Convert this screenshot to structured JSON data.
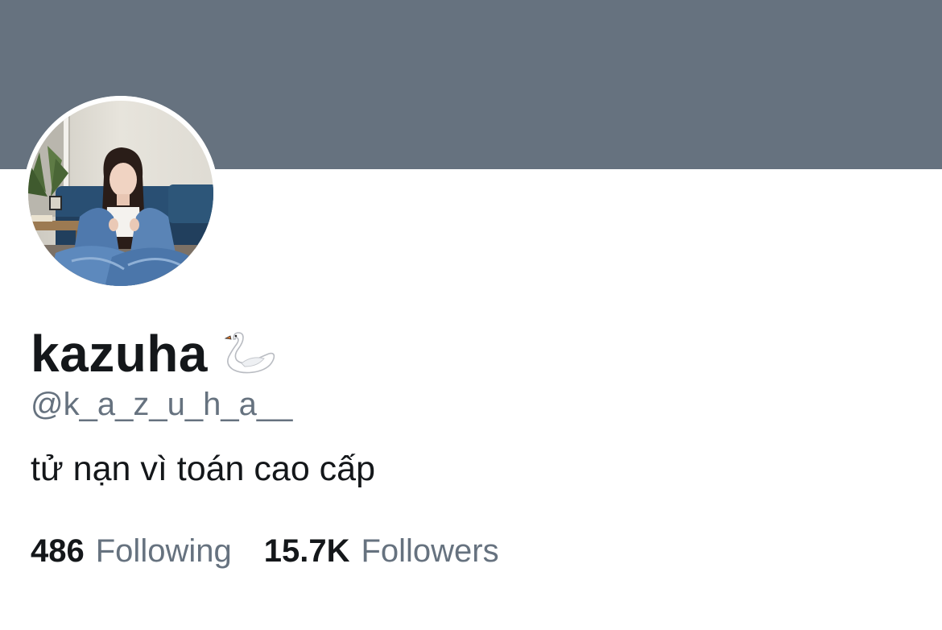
{
  "profile": {
    "display_name": "kazuha",
    "name_emoji": "swan-icon",
    "handle": "@k_a_z_u_h_a__",
    "bio": "tử nạn vì toán cao cấp",
    "following_count": "486",
    "following_label": "Following",
    "followers_count": "15.7K",
    "followers_label": "Followers"
  },
  "colors": {
    "banner": "#66727f",
    "primary_text": "#14171a",
    "secondary_text": "#66727f",
    "background": "#ffffff"
  }
}
